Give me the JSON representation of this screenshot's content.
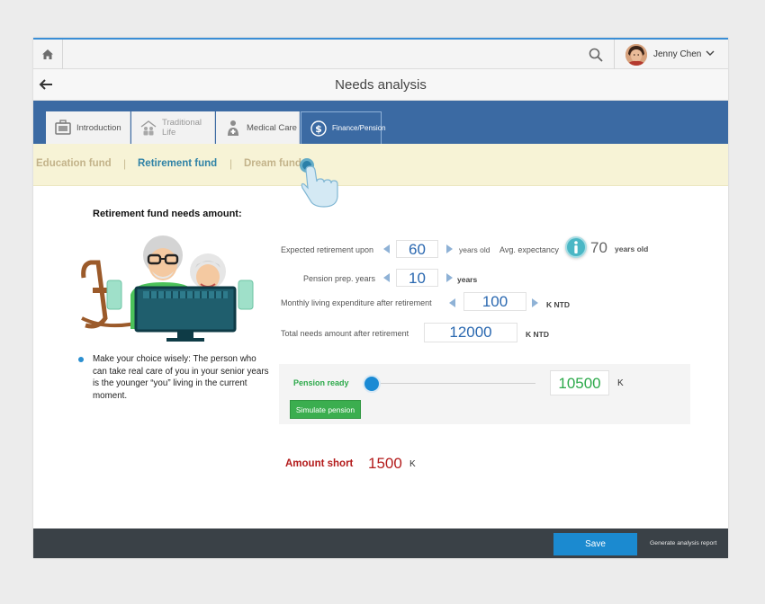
{
  "header": {
    "user_name": "Jenny Chen"
  },
  "title_bar": {
    "title": "Needs analysis"
  },
  "tabs": [
    {
      "label": "Introduction",
      "icon": "briefcase-icon",
      "active": false
    },
    {
      "label": "Traditional Life",
      "icon": "family-icon",
      "active": false
    },
    {
      "label": "Medical Care",
      "icon": "doctor-icon",
      "active": false
    },
    {
      "label": "Finance/Pension",
      "icon": "dollar-icon",
      "active": true
    }
  ],
  "sub_nav": {
    "items": [
      "Education fund",
      "Retirement fund",
      "Dream fund"
    ],
    "separator": "|",
    "active": "Retirement fund"
  },
  "section": {
    "title": "Retirement fund needs amount:",
    "tip": "Make your choice wisely: The person who can take real care of you in your senior years is the younger  “you” living in the current moment."
  },
  "form": {
    "retirement_age": {
      "label": "Expected retirement upon",
      "value": "60",
      "unit": "years old"
    },
    "avg_expectancy": {
      "label": "Avg. expectancy",
      "value": "70",
      "unit": "years old"
    },
    "pension_prep": {
      "label": "Pension prep. years",
      "value": "10",
      "unit": "years"
    },
    "monthly_expenditure": {
      "label": "Monthly living expenditure after retirement",
      "value": "100",
      "unit": "K NTD"
    },
    "total_needs": {
      "label": "Total needs amount after retirement",
      "value": "12000",
      "unit": "K NTD"
    }
  },
  "pension": {
    "label": "Pension ready",
    "value": "10500",
    "unit": "K",
    "slider_level": 0,
    "simulate_label": "Simulate pension"
  },
  "shortfall": {
    "label": "Amount short",
    "value": "1500",
    "unit": "K"
  },
  "footer": {
    "save_label": "Save",
    "report_label": "Generate analysis report"
  },
  "colors": {
    "accent_blue": "#3b6aa3",
    "link_blue": "#2f82a6",
    "value_blue": "#2a68b0",
    "pension_green": "#2ca94a",
    "shortfall_red": "#b31b1b",
    "footer_dark": "#3a4147",
    "subnav_bg": "#f7f3d6"
  }
}
